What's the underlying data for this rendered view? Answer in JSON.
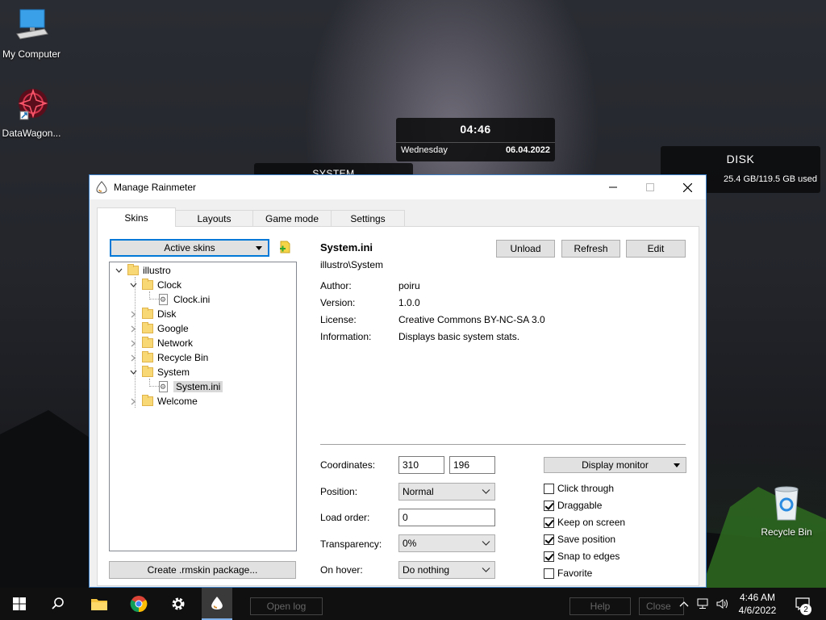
{
  "desktop": {
    "icons": [
      {
        "label": "My Computer"
      },
      {
        "label": "DataWagon..."
      },
      {
        "label": "Recycle Bin"
      }
    ],
    "widgets": {
      "clock": {
        "time": "04:46",
        "day": "Wednesday",
        "date": "06.04.2022"
      },
      "disk": {
        "title": "DISK",
        "used": "25.4 GB/119.5 GB used"
      },
      "system": {
        "title": "SYSTEM"
      }
    }
  },
  "window": {
    "title": "Manage Rainmeter",
    "tabs": [
      {
        "label": "Skins"
      },
      {
        "label": "Layouts"
      },
      {
        "label": "Game mode"
      },
      {
        "label": "Settings"
      }
    ],
    "skins_panel": {
      "dropdown": "Active skins",
      "tree": [
        {
          "label": "illustro"
        },
        {
          "label": "Clock"
        },
        {
          "label": "Clock.ini"
        },
        {
          "label": "Disk"
        },
        {
          "label": "Google"
        },
        {
          "label": "Network"
        },
        {
          "label": "Recycle Bin"
        },
        {
          "label": "System"
        },
        {
          "label": "System.ini"
        },
        {
          "label": "Welcome"
        }
      ],
      "create_package": "Create .rmskin package..."
    },
    "details": {
      "name": "System.ini",
      "path": "illustro\\System",
      "buttons": {
        "unload": "Unload",
        "refresh": "Refresh",
        "edit": "Edit"
      },
      "info": [
        {
          "label": "Author:",
          "value": "poiru"
        },
        {
          "label": "Version:",
          "value": "1.0.0"
        },
        {
          "label": "License:",
          "value": "Creative Commons BY-NC-SA 3.0"
        },
        {
          "label": "Information:",
          "value": "Displays basic system stats."
        }
      ],
      "settings": {
        "coordinates_label": "Coordinates:",
        "coord_x": "310",
        "coord_y": "196",
        "position_label": "Position:",
        "position_value": "Normal",
        "load_order_label": "Load order:",
        "load_order_value": "0",
        "transparency_label": "Transparency:",
        "transparency_value": "0%",
        "on_hover_label": "On hover:",
        "on_hover_value": "Do nothing",
        "display_monitor": "Display monitor"
      },
      "checkboxes": [
        {
          "label": "Click through",
          "checked": false
        },
        {
          "label": "Draggable",
          "checked": true
        },
        {
          "label": "Keep on screen",
          "checked": true
        },
        {
          "label": "Save position",
          "checked": true
        },
        {
          "label": "Snap to edges",
          "checked": true
        },
        {
          "label": "Favorite",
          "checked": false
        }
      ]
    }
  },
  "taskbar": {
    "ghost_buttons": {
      "open_log": "Open log",
      "help": "Help",
      "close": "Close"
    },
    "clock": {
      "time": "4:46 AM",
      "date": "4/6/2022"
    },
    "notification_count": "2"
  }
}
